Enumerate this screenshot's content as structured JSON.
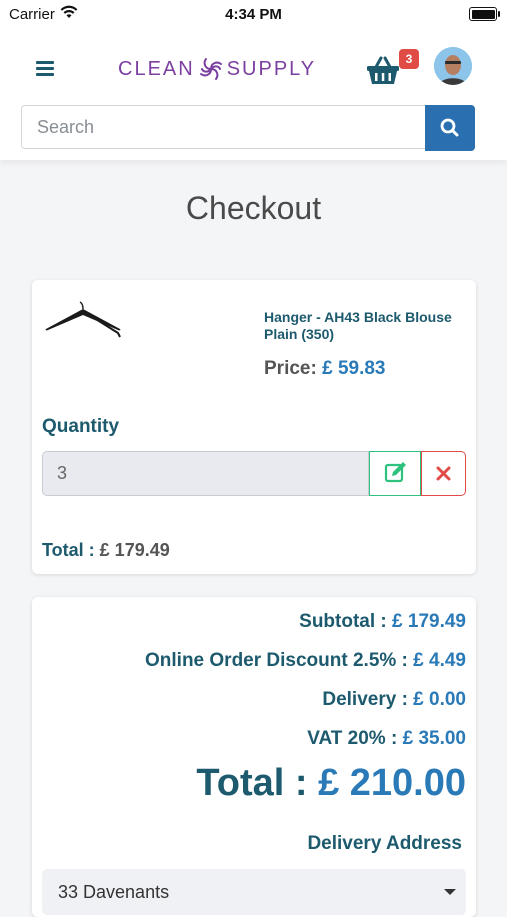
{
  "status_bar": {
    "carrier": "Carrier",
    "time": "4:34 PM"
  },
  "header": {
    "logo_left": "CLEAN",
    "logo_right": "SUPPLY",
    "cart_count": "3",
    "search": {
      "placeholder": "Search",
      "value": ""
    }
  },
  "page": {
    "title": "Checkout"
  },
  "cart_item": {
    "name": "Hanger - AH43 Black Blouse Plain (350)",
    "price_label": "Price:",
    "price": "£ 59.83",
    "quantity_label": "Quantity",
    "quantity": "3",
    "total_label": "Total :",
    "total": "£ 179.49"
  },
  "summary": {
    "subtotal_label": "Subtotal :",
    "subtotal": "£ 179.49",
    "discount_label": "Online Order Discount 2.5% :",
    "discount": "£ 4.49",
    "delivery_label": "Delivery :",
    "delivery": "£ 0.00",
    "vat_label": "VAT 20% :",
    "vat": "£ 35.00",
    "total_label": "Total :",
    "total": "£ 210.00",
    "address_label": "Delivery Address",
    "address_selected": "33 Davenants"
  },
  "colors": {
    "primary_text": "#1d5a6e",
    "accent_blue": "#2a7ab8",
    "search_button": "#2a6fb0",
    "logo_purple": "#7b3fa0",
    "badge_red": "#e04b45",
    "edit_green": "#2ec27e",
    "delete_red": "#e04b45"
  },
  "icons": [
    "wifi-icon",
    "battery-icon",
    "menu-icon",
    "basket-icon",
    "avatar",
    "search-icon",
    "hanger-image",
    "edit-icon",
    "close-icon",
    "caret-down-icon"
  ]
}
